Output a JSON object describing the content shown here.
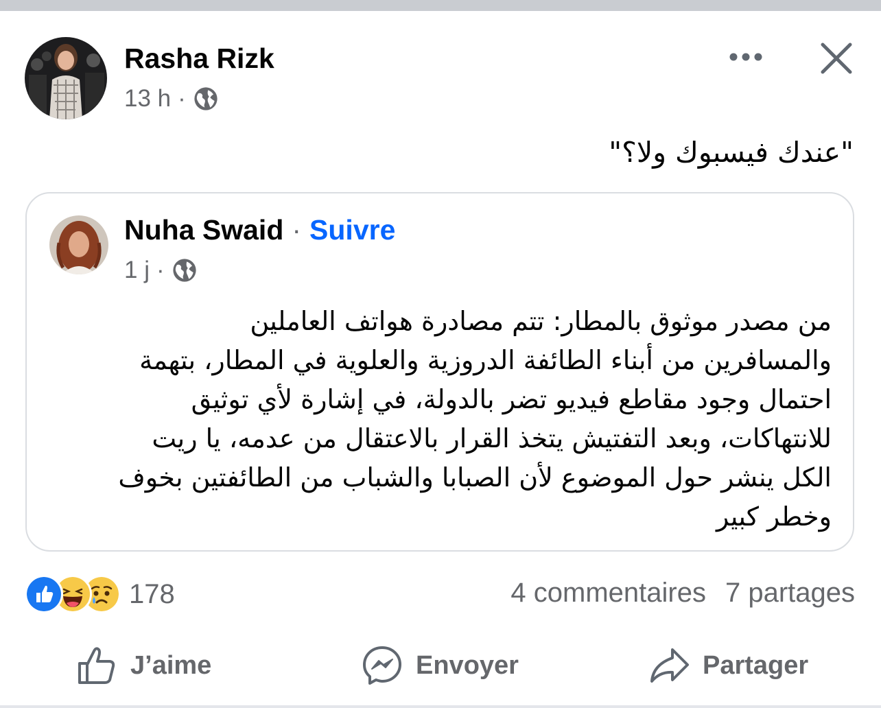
{
  "post": {
    "author": "Rasha Rizk",
    "time": "13 h",
    "separator": "·",
    "text": "\"عندك فيسبوك ولا؟\""
  },
  "shared": {
    "author": "Nuha Swaid",
    "separator": "·",
    "follow_label": "Suivre",
    "time": "1 j",
    "lines": [
      "من  مصدر موثوق بالمطار: تتم  مصادرة هواتف العاملين",
      "والمسافرين  من أبناء الطائفة الدروزية والعلوية في المطار، بتهمة",
      "احتمال وجود مقاطع فيديو تضر بالدولة،  في إشارة لأي توثيق",
      "للانتهاكات، وبعد التفتيش يتخذ القرار بالاعتقال من عدمه، يا ريت",
      "الكل ينشر حول الموضوع لأن الصبابا والشباب من الطائفتين بخوف",
      "وخطر كبير"
    ]
  },
  "reactions": {
    "icons": [
      "like-icon",
      "haha-icon",
      "sad-icon"
    ],
    "count": "178",
    "comments": "4 commentaires",
    "shares": "7 partages"
  },
  "actions": {
    "like": "J’aime",
    "send": "Envoyer",
    "share": "Partager"
  },
  "colors": {
    "link": "#0866ff",
    "secondary_text": "#65676b",
    "like_blue": "#1877f2",
    "emoji_yellow": "#f7c948"
  }
}
